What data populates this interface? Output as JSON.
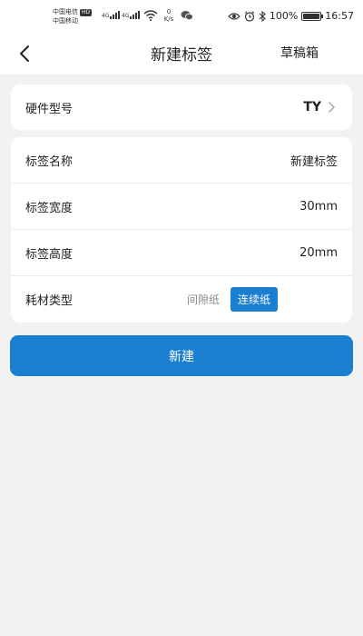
{
  "status_bar": {
    "carrier_1": "中国电信",
    "carrier_2": "中国移动",
    "hd": "HD",
    "net_1": "4G",
    "net_2": "4G",
    "speed_value": "0",
    "speed_unit": "K/s",
    "battery": "100%",
    "time": "16:57"
  },
  "nav": {
    "title": "新建标签",
    "drafts_label": "草稿箱"
  },
  "hardware": {
    "label": "硬件型号",
    "value": "TY"
  },
  "form": {
    "name_label": "标签名称",
    "name_value": "新建标签",
    "width_label": "标签宽度",
    "width_value": "30mm",
    "height_label": "标签高度",
    "height_value": "20mm",
    "media_label": "耗材类型",
    "media_options": [
      "间隙纸",
      "连续纸"
    ],
    "media_selected": "连续纸"
  },
  "actions": {
    "create_label": "新建"
  },
  "colors": {
    "accent": "#1a7fd1",
    "background": "#f2f2f2"
  }
}
